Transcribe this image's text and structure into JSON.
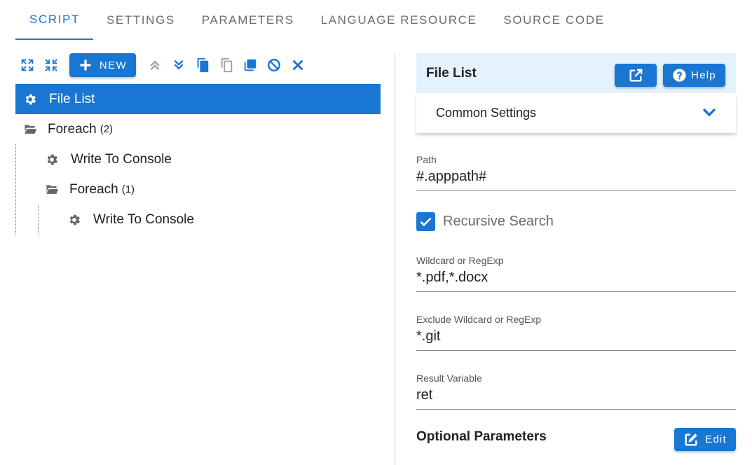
{
  "tabs": [
    {
      "label": "SCRIPT",
      "active": true
    },
    {
      "label": "SETTINGS"
    },
    {
      "label": "PARAMETERS"
    },
    {
      "label": "LANGUAGE RESOURCE"
    },
    {
      "label": "SOURCE CODE"
    }
  ],
  "toolbar": {
    "new_label": "NEW",
    "icons": [
      "expand-all-icon",
      "collapse-all-icon",
      "add-icon",
      "move-up-icon",
      "move-down-icon",
      "copy-icon",
      "paste-icon",
      "duplicate-icon",
      "disable-icon",
      "delete-icon"
    ]
  },
  "tree": [
    {
      "label": "File List",
      "icon": "gear-icon",
      "selected": true
    },
    {
      "label": "Foreach",
      "count": "(2)",
      "icon": "folder-open-icon"
    },
    {
      "label": "Write To Console",
      "icon": "gear-icon"
    },
    {
      "label": "Foreach",
      "count": "(1)",
      "icon": "folder-open-icon"
    },
    {
      "label": "Write To Console",
      "icon": "gear-icon"
    }
  ],
  "panel": {
    "title": "File List",
    "help_label": "Help",
    "common_settings": "Common Settings",
    "path_label": "Path",
    "path_value": "#.apppath#",
    "recursive_label": "Recursive Search",
    "recursive_checked": true,
    "wildcard_label": "Wildcard or RegExp",
    "wildcard_value": "*.pdf,*.docx",
    "exclude_label": "Exclude Wildcard or RegExp",
    "exclude_value": "*.git",
    "result_label": "Result Variable",
    "result_value": "ret",
    "optional_title": "Optional Parameters",
    "edit_label": "Edit"
  },
  "colors": {
    "accent": "#1976d2",
    "header_bg": "#e3f2fd",
    "disabled_icon": "#9e9e9e"
  }
}
